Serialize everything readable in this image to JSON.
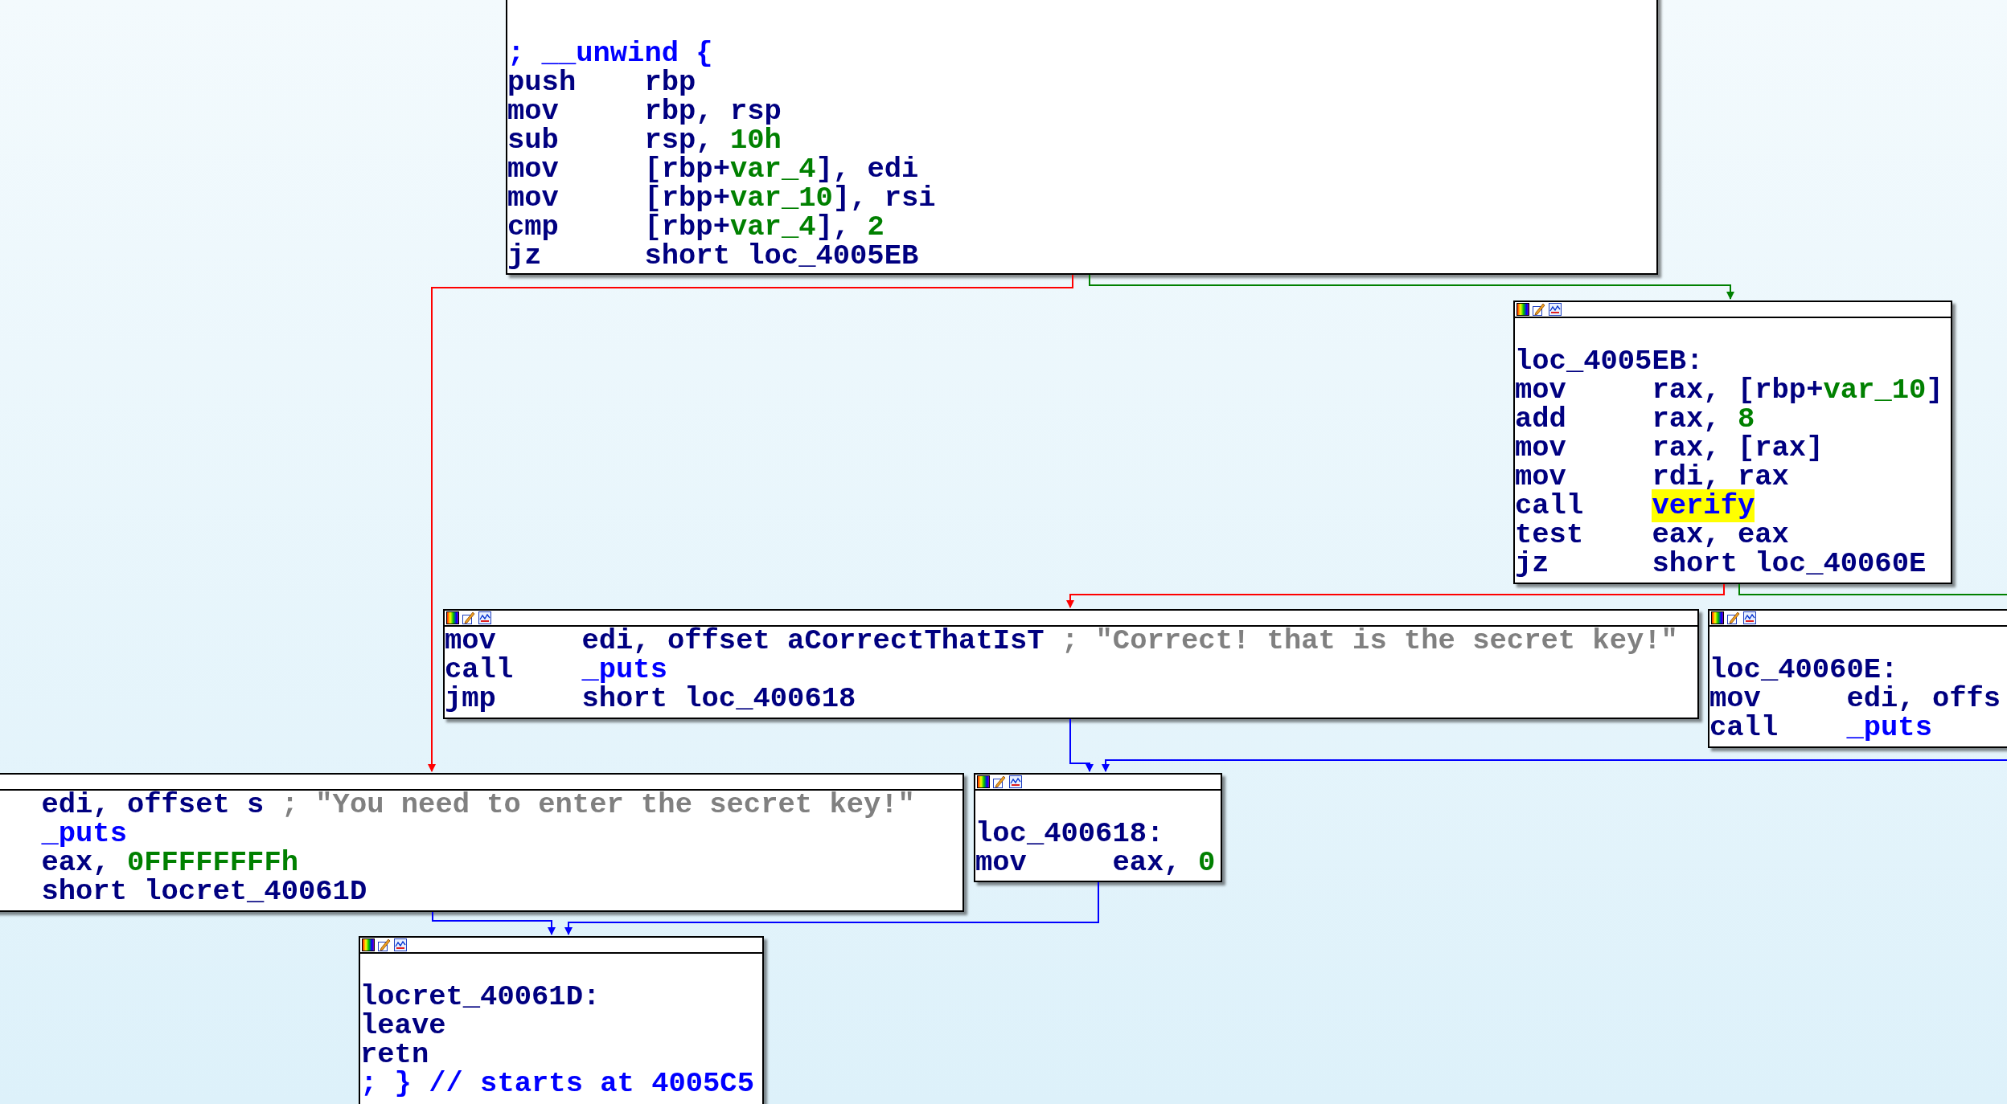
{
  "nodes": [
    {
      "header": false,
      "lines": [
        {
          "kind": "blank"
        },
        {
          "kind": "comment",
          "text": "; __unwind {"
        },
        {
          "kind": "instr",
          "mnemonic": "push",
          "operands": [
            {
              "text": "rbp",
              "kind": "plain"
            }
          ]
        },
        {
          "kind": "instr",
          "mnemonic": "mov",
          "operands": [
            {
              "text": "rbp, rsp",
              "kind": "plain"
            }
          ]
        },
        {
          "kind": "instr",
          "mnemonic": "sub",
          "operands": [
            {
              "text": "rsp, ",
              "kind": "plain"
            },
            {
              "text": "10h",
              "kind": "num"
            }
          ]
        },
        {
          "kind": "instr",
          "mnemonic": "mov",
          "operands": [
            {
              "text": "[rbp+",
              "kind": "plain"
            },
            {
              "text": "var_4",
              "kind": "num"
            },
            {
              "text": "], edi",
              "kind": "plain"
            }
          ]
        },
        {
          "kind": "instr",
          "mnemonic": "mov",
          "operands": [
            {
              "text": "[rbp+",
              "kind": "plain"
            },
            {
              "text": "var_10",
              "kind": "num"
            },
            {
              "text": "], rsi",
              "kind": "plain"
            }
          ]
        },
        {
          "kind": "instr",
          "mnemonic": "cmp",
          "operands": [
            {
              "text": "[rbp+",
              "kind": "plain"
            },
            {
              "text": "var_4",
              "kind": "num"
            },
            {
              "text": "], ",
              "kind": "plain"
            },
            {
              "text": "2",
              "kind": "num"
            }
          ]
        },
        {
          "kind": "instr",
          "mnemonic": "jz",
          "operands": [
            {
              "text": "short loc_4005EB",
              "kind": "plain"
            }
          ]
        }
      ]
    },
    {
      "header": true,
      "lines": [
        {
          "kind": "blank"
        },
        {
          "kind": "label",
          "text": "loc_4005EB:"
        },
        {
          "kind": "instr",
          "mnemonic": "mov",
          "operands": [
            {
              "text": "rax, [rbp+",
              "kind": "plain"
            },
            {
              "text": "var_10",
              "kind": "num"
            },
            {
              "text": "]",
              "kind": "plain"
            }
          ]
        },
        {
          "kind": "instr",
          "mnemonic": "add",
          "operands": [
            {
              "text": "rax, ",
              "kind": "plain"
            },
            {
              "text": "8",
              "kind": "num"
            }
          ]
        },
        {
          "kind": "instr",
          "mnemonic": "mov",
          "operands": [
            {
              "text": "rax, [rax]",
              "kind": "plain"
            }
          ]
        },
        {
          "kind": "instr",
          "mnemonic": "mov",
          "operands": [
            {
              "text": "rdi, rax",
              "kind": "plain"
            }
          ]
        },
        {
          "kind": "instr",
          "mnemonic": "call",
          "operands": [
            {
              "text": "verify",
              "kind": "func",
              "highlighted": true
            }
          ]
        },
        {
          "kind": "instr",
          "mnemonic": "test",
          "operands": [
            {
              "text": "eax, eax",
              "kind": "plain"
            }
          ]
        },
        {
          "kind": "instr",
          "mnemonic": "jz",
          "operands": [
            {
              "text": "short loc_40060E",
              "kind": "plain"
            }
          ]
        }
      ]
    },
    {
      "header": true,
      "lines": [
        {
          "kind": "instr",
          "mnemonic": "mov",
          "operands": [
            {
              "text": "edi, offset aCorrectThatIsT",
              "kind": "plain"
            }
          ],
          "comment": "; \"Correct! that is the secret key!\""
        },
        {
          "kind": "instr",
          "mnemonic": "call",
          "operands": [
            {
              "text": "_puts",
              "kind": "func"
            }
          ]
        },
        {
          "kind": "instr",
          "mnemonic": "jmp",
          "operands": [
            {
              "text": "short loc_400618",
              "kind": "plain"
            }
          ]
        }
      ]
    },
    {
      "header": true,
      "lines": [
        {
          "kind": "blank"
        },
        {
          "kind": "label",
          "text": "loc_40060E:"
        },
        {
          "kind": "instr",
          "mnemonic": "mov",
          "operands": [
            {
              "text": "edi, offs",
              "kind": "plain"
            }
          ]
        },
        {
          "kind": "instr",
          "mnemonic": "call",
          "operands": [
            {
              "text": "_puts",
              "kind": "func"
            }
          ]
        }
      ]
    },
    {
      "header": true,
      "lines": [
        {
          "kind": "instr",
          "operands": [
            {
              "text": "edi, offset s",
              "kind": "plain"
            }
          ],
          "comment": "; \"You need to enter the secret key!\""
        },
        {
          "kind": "instr",
          "operands": [
            {
              "text": "_puts",
              "kind": "func"
            }
          ]
        },
        {
          "kind": "instr",
          "operands": [
            {
              "text": "eax, ",
              "kind": "plain"
            },
            {
              "text": "0FFFFFFFFh",
              "kind": "num"
            }
          ]
        },
        {
          "kind": "instr",
          "operands": [
            {
              "text": "short locret_40061D",
              "kind": "plain"
            }
          ]
        }
      ]
    },
    {
      "header": true,
      "lines": [
        {
          "kind": "blank"
        },
        {
          "kind": "label",
          "text": "loc_400618:"
        },
        {
          "kind": "instr",
          "mnemonic": "mov",
          "operands": [
            {
              "text": "eax, ",
              "kind": "plain"
            },
            {
              "text": "0",
              "kind": "num"
            }
          ]
        }
      ]
    },
    {
      "header": true,
      "lines": [
        {
          "kind": "blank"
        },
        {
          "kind": "label",
          "text": "locret_40061D:"
        },
        {
          "kind": "instr",
          "mnemonic": "leave"
        },
        {
          "kind": "instr",
          "mnemonic": "retn"
        },
        {
          "kind": "comment",
          "text": "; } // starts at 4005C5"
        }
      ]
    }
  ],
  "edges": [
    {
      "kind": "false"
    },
    {
      "kind": "true"
    },
    {
      "kind": "false"
    },
    {
      "kind": "true"
    },
    {
      "kind": "jump"
    },
    {
      "kind": "jump"
    },
    {
      "kind": "jump"
    },
    {
      "kind": "jump"
    }
  ]
}
